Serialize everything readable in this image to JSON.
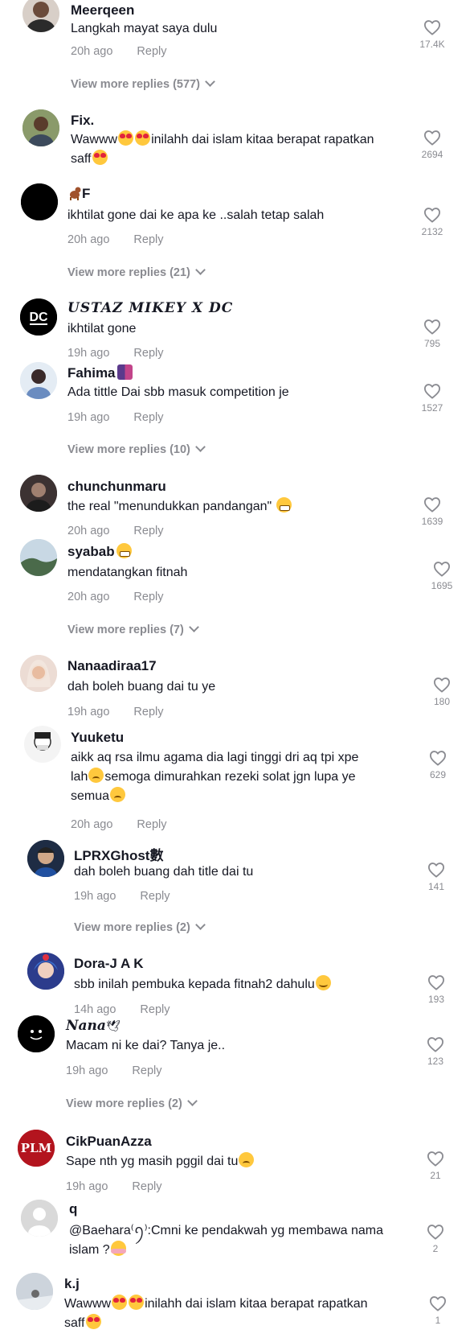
{
  "comments": [
    {
      "username": "Meerqeen",
      "text": "Langkah mayat saya dulu",
      "time": "20h ago",
      "reply": "Reply",
      "likes": "17.4K"
    },
    {
      "username": "Fix.",
      "text_parts": [
        "Wawww",
        "inilahh dai islam kitaa berapat rapatkan",
        "saff"
      ],
      "time": "",
      "reply": "",
      "likes": "2694"
    },
    {
      "username": "F",
      "text": "ikhtilat gone dai ke apa ke ..salah tetap salah",
      "time": "20h ago",
      "reply": "Reply",
      "likes": "2132"
    },
    {
      "username": "USTAZ MIKEY X DC",
      "avatar_text": "DC",
      "text": "ikhtilat gone",
      "time": "19h ago",
      "reply": "Reply",
      "likes": "795"
    },
    {
      "username": "Fahima",
      "text": "Ada tittle Dai sbb masuk competition je",
      "time": "19h ago",
      "reply": "Reply",
      "likes": "1527"
    },
    {
      "username": "chunchunmaru",
      "text": "the real \"menundukkan pandangan\"",
      "time": "20h ago",
      "reply": "Reply",
      "likes": "1639"
    },
    {
      "username": "syabab",
      "text": "mendatangkan fitnah",
      "time": "20h ago",
      "reply": "Reply",
      "likes": "1695"
    },
    {
      "username": "Nanaadiraa17",
      "text": "dah boleh buang dai tu ye",
      "time": "19h ago",
      "reply": "Reply",
      "likes": "180"
    },
    {
      "username": "Yuuketu",
      "text_parts": [
        "aikk aq rsa ilmu agama dia lagi tinggi dri aq tpi xpe",
        "lah",
        "semoga dimurahkan rezeki solat jgn lupa ye",
        "semua"
      ],
      "time": "20h ago",
      "reply": "Reply",
      "likes": "629"
    },
    {
      "username": "LPRXGhost數",
      "text": "dah boleh buang dah title dai tu",
      "time": "19h ago",
      "reply": "Reply",
      "likes": "141"
    },
    {
      "username": "Dora-J A K",
      "text": "sbb inilah pembuka kepada fitnah2 dahulu",
      "time": "14h ago",
      "reply": "Reply",
      "likes": "193"
    },
    {
      "username": "Nana",
      "text": "Macam ni ke dai? Tanya je..",
      "time": "19h ago",
      "reply": "Reply",
      "likes": "123"
    },
    {
      "username": "CikPuanAzza",
      "avatar_text": "PLM",
      "text": "Sape nth yg masih pggil dai tu",
      "time": "19h ago",
      "reply": "Reply",
      "likes": "21"
    },
    {
      "username": "q",
      "text_parts": [
        "@Baehara",
        "⁽ꪆ⁾:Cmni ke pendakwah yg membawa nama",
        "islam ?"
      ],
      "time": "",
      "reply": "",
      "likes": "2"
    },
    {
      "username": "k.j",
      "text_parts": [
        "Wawww",
        "inilahh dai islam kitaa berapat rapatkan",
        "saff"
      ],
      "time": "",
      "reply": "",
      "likes": "1"
    }
  ],
  "view_more": [
    "View more replies (577)",
    "View more replies (21)",
    "View more replies (10)",
    "View more replies (7)",
    "View more replies (2)",
    "View more replies (2)"
  ],
  "colors": {
    "text": "#161823",
    "muted": "#8a8b91",
    "background": "#ffffff"
  },
  "icons": {
    "like": "heart-outline-icon",
    "expand": "chevron-down-icon"
  }
}
